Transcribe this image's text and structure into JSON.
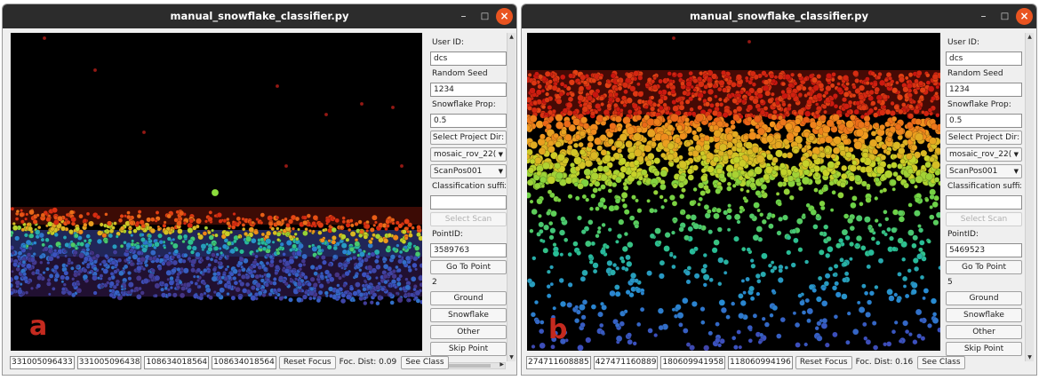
{
  "windows": [
    {
      "title": "manual_snowflake_classifier.py",
      "figure_label": "a",
      "panel": {
        "user_id_label": "User ID:",
        "user_id": "dcs",
        "seed_label": "Random Seed",
        "seed": "1234",
        "prop_label": "Snowflake Prop:",
        "prop": "0.5",
        "select_dir_label": "Select Project Dir:",
        "project": "mosaic_rov_22(",
        "scanpos": "ScanPos001",
        "suffix_label": "Classification suffix:",
        "suffix": "",
        "select_scan_label": "Select Scan",
        "point_id_label": "PointID:",
        "point_id": "3589763",
        "goto_label": "Go To Point",
        "count": "2",
        "ground_label": "Ground",
        "snowflake_label": "Snowflake",
        "other_label": "Other",
        "skip_label": "Skip Point"
      },
      "bottom": {
        "f1": "331005096433",
        "f2": "331005096438",
        "f3": "108634018564",
        "f4": "108634018564",
        "reset_label": "Reset Focus",
        "focdist": "Foc. Dist: 0.09",
        "see_class_label": "See Class"
      }
    },
    {
      "title": "manual_snowflake_classifier.py",
      "figure_label": "b",
      "panel": {
        "user_id_label": "User ID:",
        "user_id": "dcs",
        "seed_label": "Random Seed",
        "seed": "1234",
        "prop_label": "Snowflake Prop:",
        "prop": "0.5",
        "select_dir_label": "Select Project Dir:",
        "project": "mosaic_rov_22(",
        "scanpos": "ScanPos001",
        "suffix_label": "Classification suffix:",
        "suffix": "",
        "select_scan_label": "Select Scan",
        "point_id_label": "PointID:",
        "point_id": "5469523",
        "goto_label": "Go To Point",
        "count": "5",
        "ground_label": "Ground",
        "snowflake_label": "Snowflake",
        "other_label": "Other",
        "skip_label": "Skip Point"
      },
      "bottom": {
        "f1": "274711608885",
        "f2": "427471160889",
        "f3": "180609941958",
        "f4": "118060994196",
        "reset_label": "Reset Focus",
        "focdist": "Foc. Dist: 0.16",
        "see_class_label": "See Class"
      }
    }
  ],
  "colors": {
    "titlebar": "#2c2c2c",
    "close_button": "#e95420",
    "figure_label": "#c42a1f",
    "viewer_background": "#000000"
  },
  "icons": [
    "minimize-icon",
    "maximize-icon",
    "close-icon",
    "chevron-down-icon",
    "scroll-arrow-icon"
  ]
}
